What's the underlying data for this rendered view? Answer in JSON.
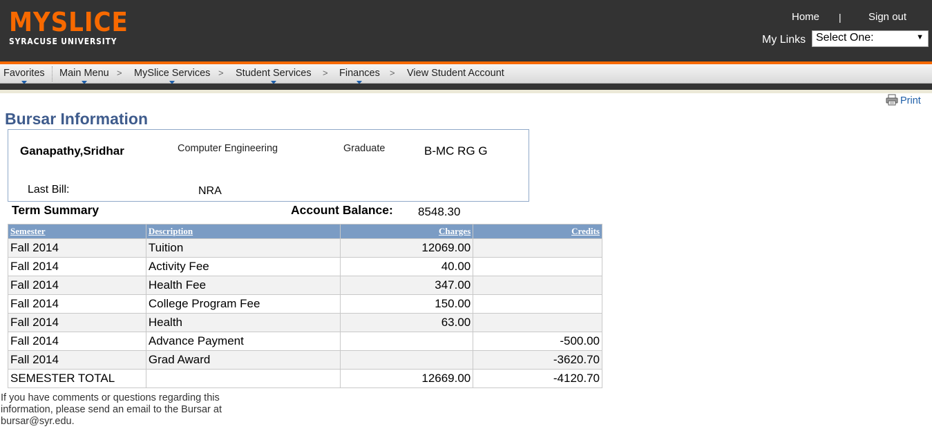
{
  "header": {
    "logo_main": "MYSLICE",
    "logo_sub": "SYRACUSE UNIVERSITY",
    "home_label": "Home",
    "separator": "|",
    "signout_label": "Sign out",
    "mylinks_label": "My Links",
    "mylinks_selected": "Select One:"
  },
  "breadcrumb": {
    "items": [
      "Favorites",
      "Main Menu",
      "MySlice Services",
      "Student Services",
      "Finances",
      "View Student Account"
    ],
    "separator": ">"
  },
  "print_label": "Print",
  "page_title": "Bursar Information",
  "student": {
    "name": "Ganapathy,Sridhar",
    "program": "Computer Engineering",
    "career": "Graduate",
    "code": "B-MC RG G",
    "last_bill_label": "Last Bill:",
    "last_bill_value": "NRA"
  },
  "term_summary_label": "Term Summary",
  "account_balance_label": "Account Balance:",
  "account_balance_value": "8548.30",
  "table": {
    "headers": [
      "Semester",
      "Description",
      "Charges",
      "Credits"
    ],
    "rows": [
      {
        "semester": "Fall 2014",
        "description": "Tuition",
        "charges": "12069.00",
        "credits": ""
      },
      {
        "semester": "Fall 2014",
        "description": "Activity Fee",
        "charges": "40.00",
        "credits": ""
      },
      {
        "semester": "Fall 2014",
        "description": "Health Fee",
        "charges": "347.00",
        "credits": ""
      },
      {
        "semester": "Fall 2014",
        "description": "College Program Fee",
        "charges": "150.00",
        "credits": ""
      },
      {
        "semester": "Fall 2014",
        "description": "Health",
        "charges": "63.00",
        "credits": ""
      },
      {
        "semester": "Fall 2014",
        "description": "Advance Payment",
        "charges": "",
        "credits": "-500.00"
      },
      {
        "semester": "Fall 2014",
        "description": "Grad Award",
        "charges": "",
        "credits": "-3620.70"
      },
      {
        "semester": "SEMESTER TOTAL",
        "description": "",
        "charges": "12669.00",
        "credits": "-4120.70"
      }
    ]
  },
  "footer_note": "If you have comments or questions regarding this information, please send an email to the Bursar at bursar@syr.edu.",
  "colors": {
    "header_bg": "#333333",
    "brand_orange": "#f76900",
    "title_blue": "#3e5b8c",
    "table_header_bg": "#7b9cc4",
    "link_blue": "#1f5fa8"
  }
}
